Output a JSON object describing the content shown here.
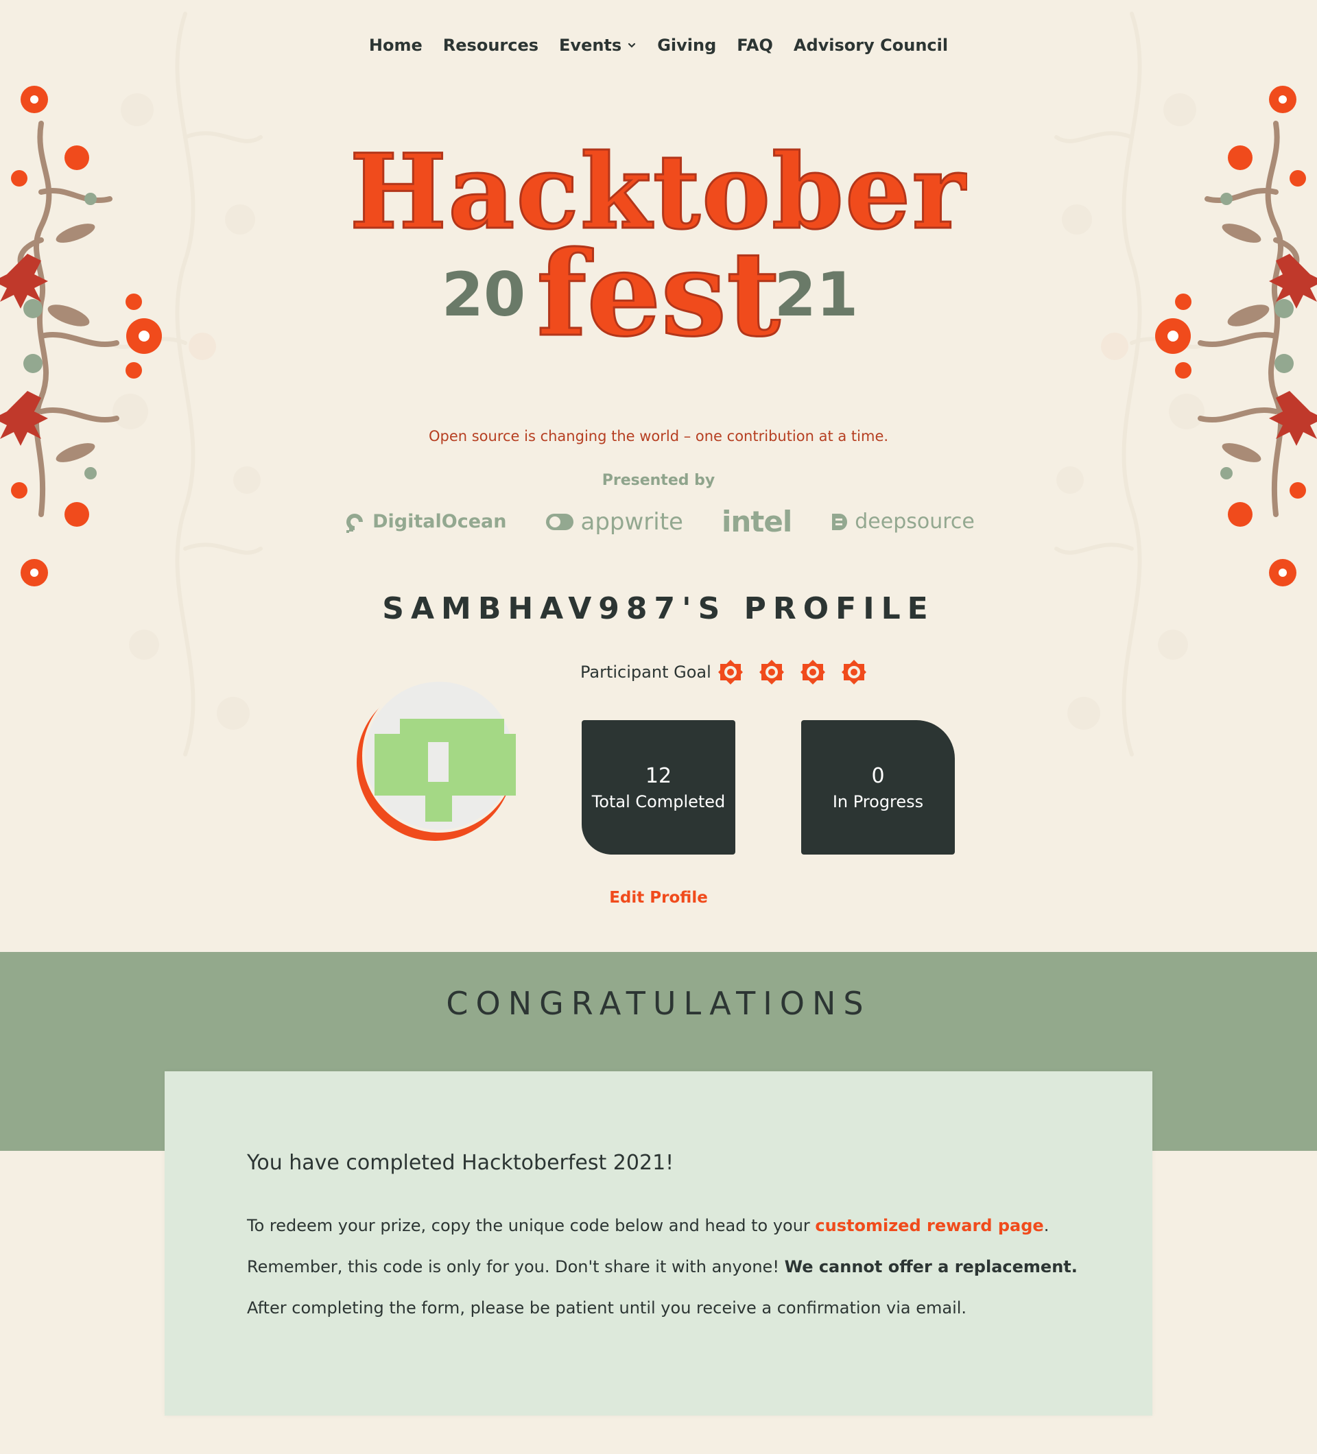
{
  "nav": {
    "items": [
      {
        "label": "Home"
      },
      {
        "label": "Resources"
      },
      {
        "label": "Events"
      },
      {
        "label": "Giving"
      },
      {
        "label": "FAQ"
      },
      {
        "label": "Advisory Council"
      }
    ]
  },
  "logo": {
    "line1": "Hacktober",
    "year_left": "20",
    "line2": "fest",
    "year_right": "21"
  },
  "tagline": "Open source is changing the world – one contribution at a time.",
  "sponsors": {
    "presented_by": "Presented by",
    "items": [
      {
        "name": "DigitalOcean",
        "icon": "digitalocean-logo-icon"
      },
      {
        "name": "appwrite",
        "icon": "appwrite-logo-icon"
      },
      {
        "name": "intel",
        "icon": ""
      },
      {
        "name": "deepsource",
        "icon": "deepsource-logo-icon"
      }
    ]
  },
  "profile": {
    "title": "SAMBHAV987'S PROFILE",
    "goal_label": "Participant Goal",
    "goal_icon": "flower-badge-icon",
    "goal_count": 4,
    "stats": {
      "total_completed": {
        "value": "12",
        "label": "Total Completed"
      },
      "in_progress": {
        "value": "0",
        "label": "In Progress"
      }
    },
    "edit_label": "Edit Profile"
  },
  "congrats": {
    "heading": "CONGRATULATIONS",
    "completed": "You have completed Hacktoberfest 2021!",
    "redeem_before": "To redeem your prize, copy the unique code below and head to your ",
    "redeem_link": "customized reward page",
    "redeem_after": ".",
    "remember_text": "Remember, this code is only for you. Don't share it with anyone! ",
    "remember_bold": "We cannot offer a replacement.",
    "after_form": "After completing the form, please be patient until you receive a confirmation via email."
  },
  "colors": {
    "background": "#f5efe3",
    "accent_orange": "#f04b1c",
    "dark": "#2c3533",
    "sage": "#93a98c",
    "card": "#dde9db"
  }
}
